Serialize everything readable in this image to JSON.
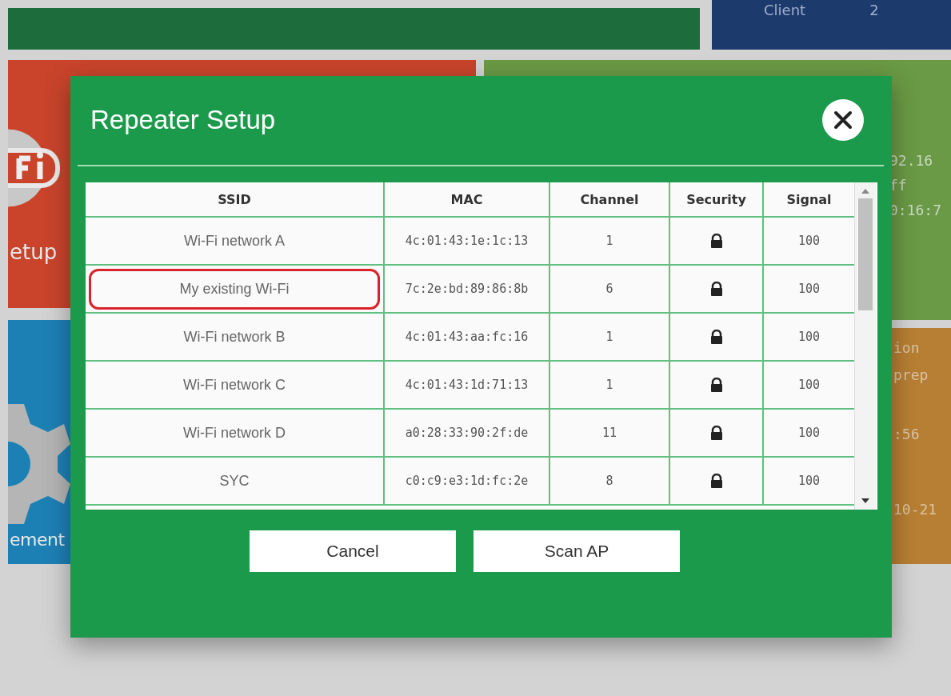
{
  "background": {
    "top_tiles": [
      {
        "kind": "plain"
      },
      {
        "kind": "client",
        "texts": [
          "Client",
          "2"
        ]
      }
    ],
    "left_tiles": [
      {
        "kind": "wifi",
        "label": "etup"
      },
      {
        "kind": "gear",
        "label": "ement"
      }
    ],
    "right_tiles": [
      {
        "kind": "olive",
        "lines": [
          "92.16",
          "ff",
          "0:16:7"
        ]
      },
      {
        "kind": "orange",
        "lines": [
          "ion",
          "prep",
          ":56",
          "10-21"
        ]
      }
    ]
  },
  "dialog": {
    "title": "Repeater Setup",
    "table": {
      "columns": [
        "SSID",
        "MAC",
        "Channel",
        "Security",
        "Signal"
      ],
      "rows": [
        {
          "ssid": "Wi-Fi network A",
          "mac": "4c:01:43:1e:1c:13",
          "channel": "1",
          "secured": true,
          "signal": "100",
          "highlighted": false
        },
        {
          "ssid": "My existing Wi-Fi",
          "mac": "7c:2e:bd:89:86:8b",
          "channel": "6",
          "secured": true,
          "signal": "100",
          "highlighted": true
        },
        {
          "ssid": "Wi-Fi network B",
          "mac": "4c:01:43:aa:fc:16",
          "channel": "1",
          "secured": true,
          "signal": "100",
          "highlighted": false
        },
        {
          "ssid": "Wi-Fi network C",
          "mac": "4c:01:43:1d:71:13",
          "channel": "1",
          "secured": true,
          "signal": "100",
          "highlighted": false
        },
        {
          "ssid": "Wi-Fi network D",
          "mac": "a0:28:33:90:2f:de",
          "channel": "11",
          "secured": true,
          "signal": "100",
          "highlighted": false
        },
        {
          "ssid": "SYC",
          "mac": "c0:c9:e3:1d:fc:2e",
          "channel": "8",
          "secured": true,
          "signal": "100",
          "highlighted": false
        }
      ]
    },
    "buttons": [
      "Cancel",
      "Scan AP"
    ]
  }
}
